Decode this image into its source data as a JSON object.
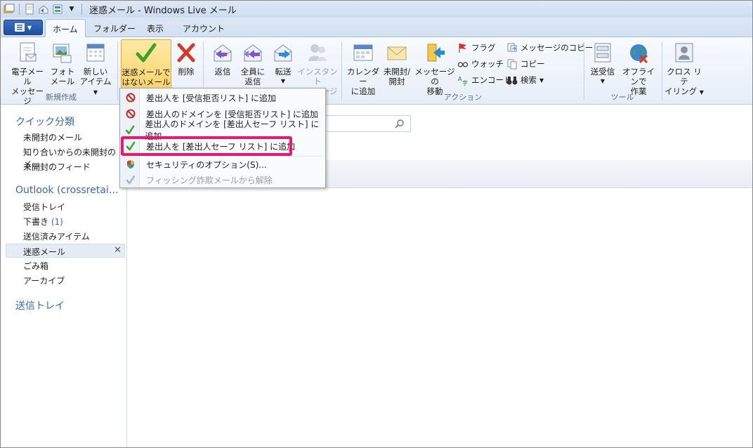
{
  "window": {
    "title": "迷惑メール - Windows Live メール"
  },
  "tabs": [
    {
      "label": "ホーム",
      "active": true
    },
    {
      "label": "フォルダー",
      "active": false
    },
    {
      "label": "表示",
      "active": false
    },
    {
      "label": "アカウント",
      "active": false
    }
  ],
  "ribbon": {
    "new_group": {
      "label": "新規作成",
      "email": [
        "電子メール",
        "メッセージ"
      ],
      "photo": [
        "フォト",
        "メール"
      ],
      "new_items": [
        "新しい",
        "アイテム"
      ]
    },
    "junk_group": {
      "not_junk": [
        "迷惑メールで",
        "はないメール"
      ],
      "delete": "削除"
    },
    "respond_group": {
      "reply": "返信",
      "reply_all": [
        "全員に",
        "返信"
      ],
      "forward": "転送",
      "instant": [
        "インスタント",
        "メッセージ"
      ]
    },
    "actions_group": {
      "label": "アクション",
      "calendar": [
        "カレンダー",
        "に追加"
      ],
      "unread": [
        "未開封/",
        "開封"
      ],
      "move": [
        "メッセージの",
        "移動"
      ],
      "flag": "フラグ",
      "watch": "ウォッチ",
      "encode": "エンコード",
      "copy_message": "メッセージのコピー",
      "copy": "コピー",
      "find": "検索"
    },
    "tools_group": {
      "label": "ツール",
      "send_receive": "送受信",
      "offline": [
        "オフラインで",
        "作業"
      ],
      "crossposting": [
        "クロス リテ",
        "イリング"
      ]
    }
  },
  "nav": {
    "quick_views_header": "クイック分類",
    "quick_views": [
      "未開封のメール",
      "知り合いからの未開封のメ…",
      "未開封のフィード"
    ],
    "account_header": "Outlook (crossretai…",
    "folders": [
      {
        "label": "受信トレイ"
      },
      {
        "label": "下書き",
        "count": "(1)"
      },
      {
        "label": "送信済みアイテム"
      },
      {
        "label": "迷惑メール",
        "selected": true
      },
      {
        "label": "ごみ箱"
      },
      {
        "label": "アーカイブ"
      }
    ],
    "outbox_header": "送信トレイ"
  },
  "menu": {
    "items": [
      {
        "label": "差出人を [受信拒否リスト] に追加",
        "icon": "block-icon"
      },
      {
        "label": "差出人のドメインを [受信拒否リスト] に追加",
        "icon": "block-icon"
      },
      {
        "label": "差出人のドメインを [差出人セーフ リスト] に追加",
        "icon": "check-icon"
      },
      {
        "label": "差出人を [差出人セーフ リスト] に追加",
        "icon": "check-icon",
        "highlighted": true
      },
      {
        "label": "セキュリティのオプション(S)...",
        "icon": "shield-icon"
      },
      {
        "label": "フィッシング詐欺メールから解除",
        "icon": "check-icon",
        "disabled": true
      }
    ]
  },
  "colors": {
    "highlight_border": "#e8186d",
    "nav_header": "#3d6aa8",
    "app_button": "#2a5cae"
  }
}
